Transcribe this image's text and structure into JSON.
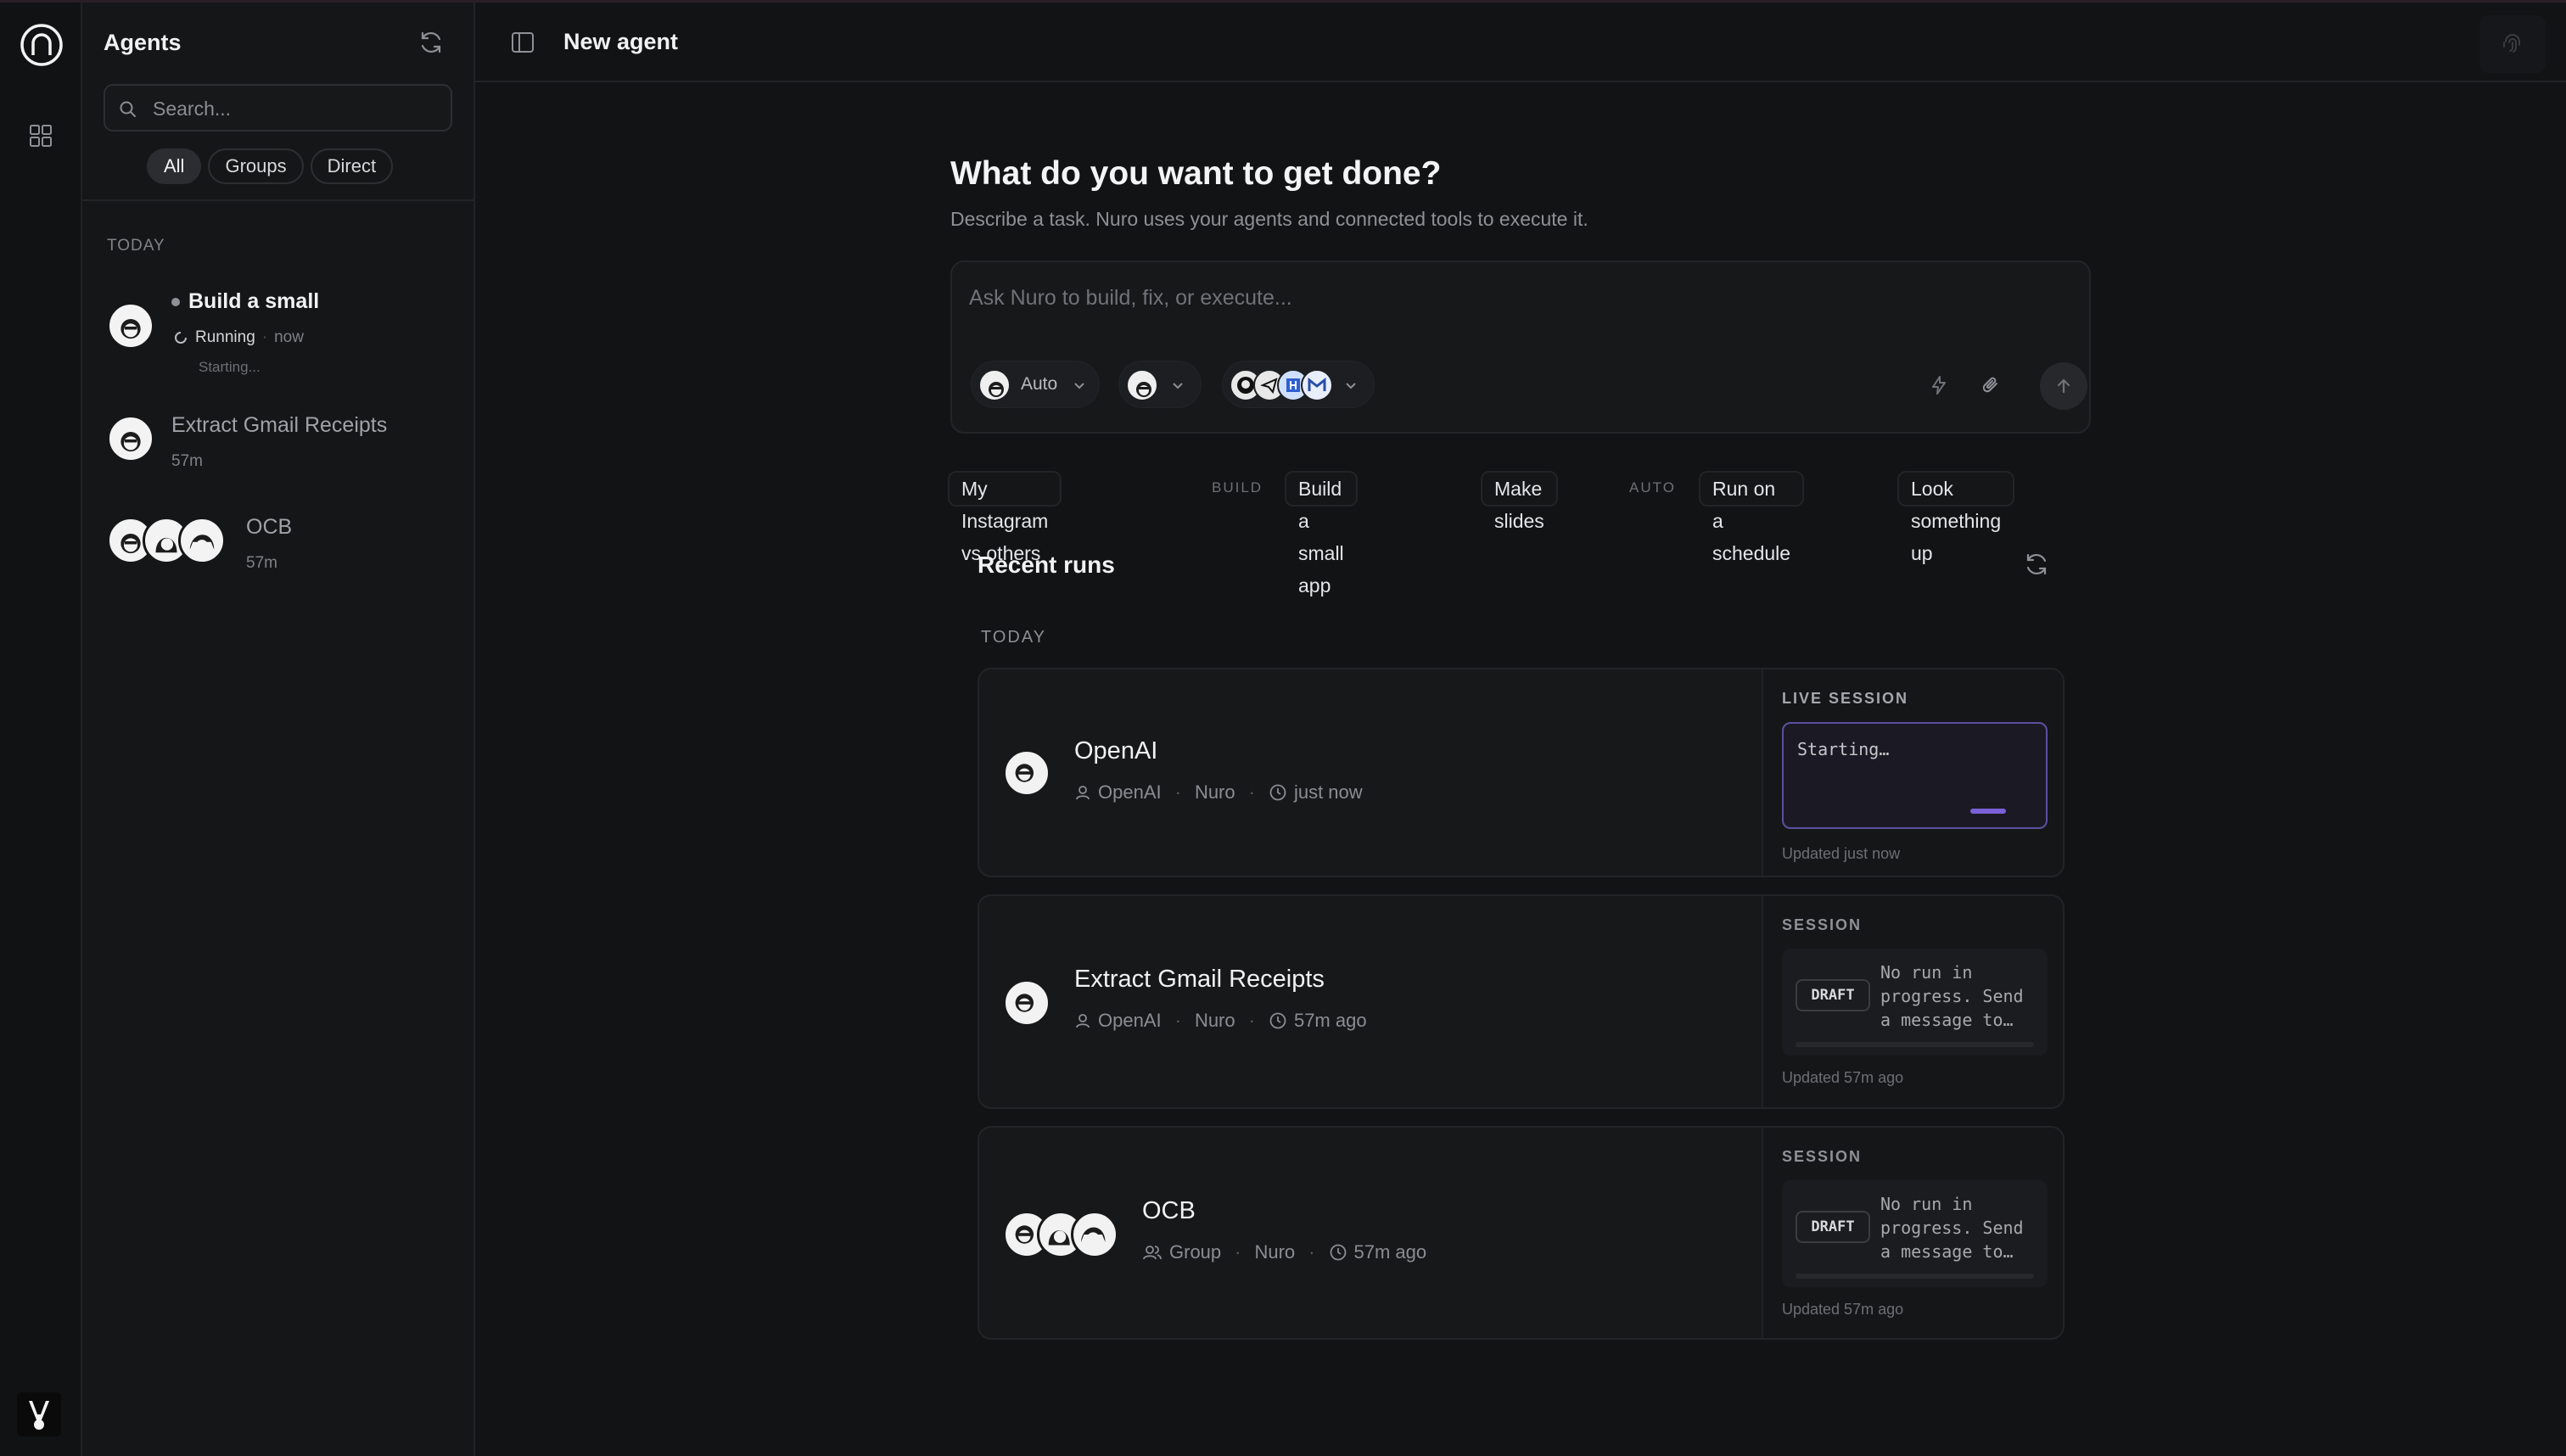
{
  "sidebar": {
    "title": "Agents",
    "search_placeholder": "Search...",
    "filters": [
      "All",
      "Groups",
      "Direct"
    ],
    "section": "TODAY",
    "conversations": [
      {
        "title": "Build a small",
        "status": "Running",
        "time": "now",
        "detail": "Starting..."
      },
      {
        "title": "Extract Gmail Receipts",
        "time": "57m"
      },
      {
        "title": "OCB",
        "time": "57m"
      }
    ]
  },
  "header": {
    "title": "New agent"
  },
  "hero": {
    "title": "What do you want to get done?",
    "subtitle": "Describe a task. Nuro uses your agents and connected tools to execute it."
  },
  "composer": {
    "placeholder": "Ask Nuro to build, fix, or execute...",
    "model_label": "Auto"
  },
  "suggestions": {
    "items": [
      "My Instagram vs others",
      "Build a small app",
      "Make slides",
      "Run on a schedule",
      "Look something up"
    ],
    "groups": [
      "BUILD",
      "AUTO"
    ]
  },
  "recent": {
    "title": "Recent runs",
    "section": "TODAY",
    "runs": [
      {
        "name": "OpenAI",
        "owner": "OpenAI",
        "agent": "Nuro",
        "time": "just now",
        "session_label": "LIVE SESSION",
        "session_text": "Starting…",
        "updated": "Updated just now"
      },
      {
        "name": "Extract Gmail Receipts",
        "owner": "OpenAI",
        "agent": "Nuro",
        "time": "57m ago",
        "session_label": "SESSION",
        "badge": "DRAFT",
        "session_text": "No run in progress. Send a message to…",
        "updated": "Updated 57m ago"
      },
      {
        "name": "OCB",
        "owner": "Group",
        "agent": "Nuro",
        "time": "57m ago",
        "session_label": "SESSION",
        "badge": "DRAFT",
        "session_text": "No run in progress. Send a message to…",
        "updated": "Updated 57m ago"
      }
    ]
  },
  "icons": {
    "rail": [
      "nuro-logo-icon",
      "grid-icon",
      "rabbit-logo-icon"
    ],
    "header": [
      "sidebar-toggle-icon",
      "fingerprint-icon"
    ],
    "composer": [
      "lightning-icon",
      "paperclip-icon",
      "arrow-up-icon"
    ],
    "tools": [
      "github-icon",
      "telegram-icon",
      "calendar-icon",
      "gmail-icon"
    ]
  },
  "colors": {
    "background": "#121314",
    "accent": "#7a62d6",
    "text": "#e9eaec"
  }
}
